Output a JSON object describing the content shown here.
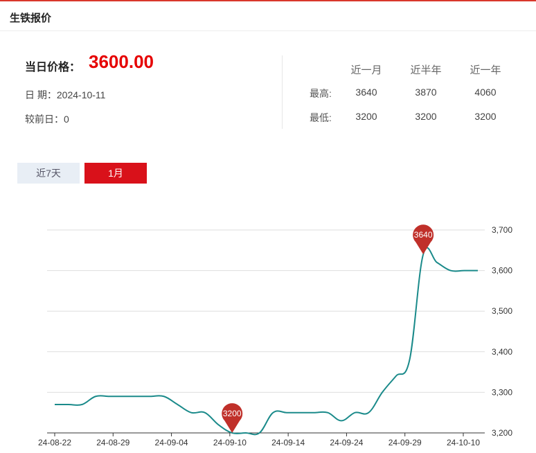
{
  "header": {
    "title": "生铁报价"
  },
  "price": {
    "label": "当日价格：",
    "value": "3600.00",
    "date_label": "日 期：",
    "date": "2024-10-11",
    "change_label": "较前日：",
    "change": "0"
  },
  "stats": {
    "columns": [
      "近一月",
      "近半年",
      "近一年"
    ],
    "rows": [
      {
        "label": "最高:",
        "values": [
          "3640",
          "3870",
          "4060"
        ]
      },
      {
        "label": "最低:",
        "values": [
          "3200",
          "3200",
          "3200"
        ]
      }
    ]
  },
  "tabs": [
    {
      "label": "近7天",
      "active": false
    },
    {
      "label": "1月",
      "active": true
    }
  ],
  "colors": {
    "accent": "#d9111a",
    "line": "#1a8a8a",
    "marker": "#c0302a",
    "price": "#e60000"
  },
  "chart_data": {
    "type": "line",
    "x_tick_labels": [
      "24-08-22",
      "24-08-29",
      "24-09-04",
      "24-09-10",
      "24-09-14",
      "24-09-24",
      "24-09-29",
      "24-10-10"
    ],
    "y_tick_labels": [
      "3,200",
      "3,300",
      "3,400",
      "3,500",
      "3,600",
      "3,700"
    ],
    "ylim": [
      3200,
      3700
    ],
    "grid": true,
    "y_axis_side": "right",
    "series": [
      {
        "x": [
          "2024-08-22",
          "2024-08-23",
          "2024-08-26",
          "2024-08-27",
          "2024-08-28",
          "2024-08-29",
          "2024-08-30",
          "2024-09-02",
          "2024-09-03",
          "2024-09-04",
          "2024-09-05",
          "2024-09-06",
          "2024-09-09",
          "2024-09-10",
          "2024-09-11",
          "2024-09-12",
          "2024-09-13",
          "2024-09-14",
          "2024-09-18",
          "2024-09-19",
          "2024-09-20",
          "2024-09-23",
          "2024-09-24",
          "2024-09-25",
          "2024-09-26",
          "2024-09-27",
          "2024-09-29",
          "2024-09-30",
          "2024-10-08",
          "2024-10-09",
          "2024-10-10",
          "2024-10-11"
        ],
        "values": [
          3270,
          3270,
          3270,
          3290,
          3290,
          3290,
          3290,
          3290,
          3290,
          3270,
          3250,
          3250,
          3220,
          3200,
          3200,
          3200,
          3250,
          3250,
          3250,
          3250,
          3250,
          3230,
          3250,
          3250,
          3300,
          3340,
          3380,
          3640,
          3620,
          3600,
          3600,
          3600
        ]
      }
    ],
    "annotations": [
      {
        "label": "3640",
        "x": "2024-09-30",
        "y": 3640
      },
      {
        "label": "3200",
        "x": "2024-09-10",
        "y": 3200
      }
    ]
  }
}
